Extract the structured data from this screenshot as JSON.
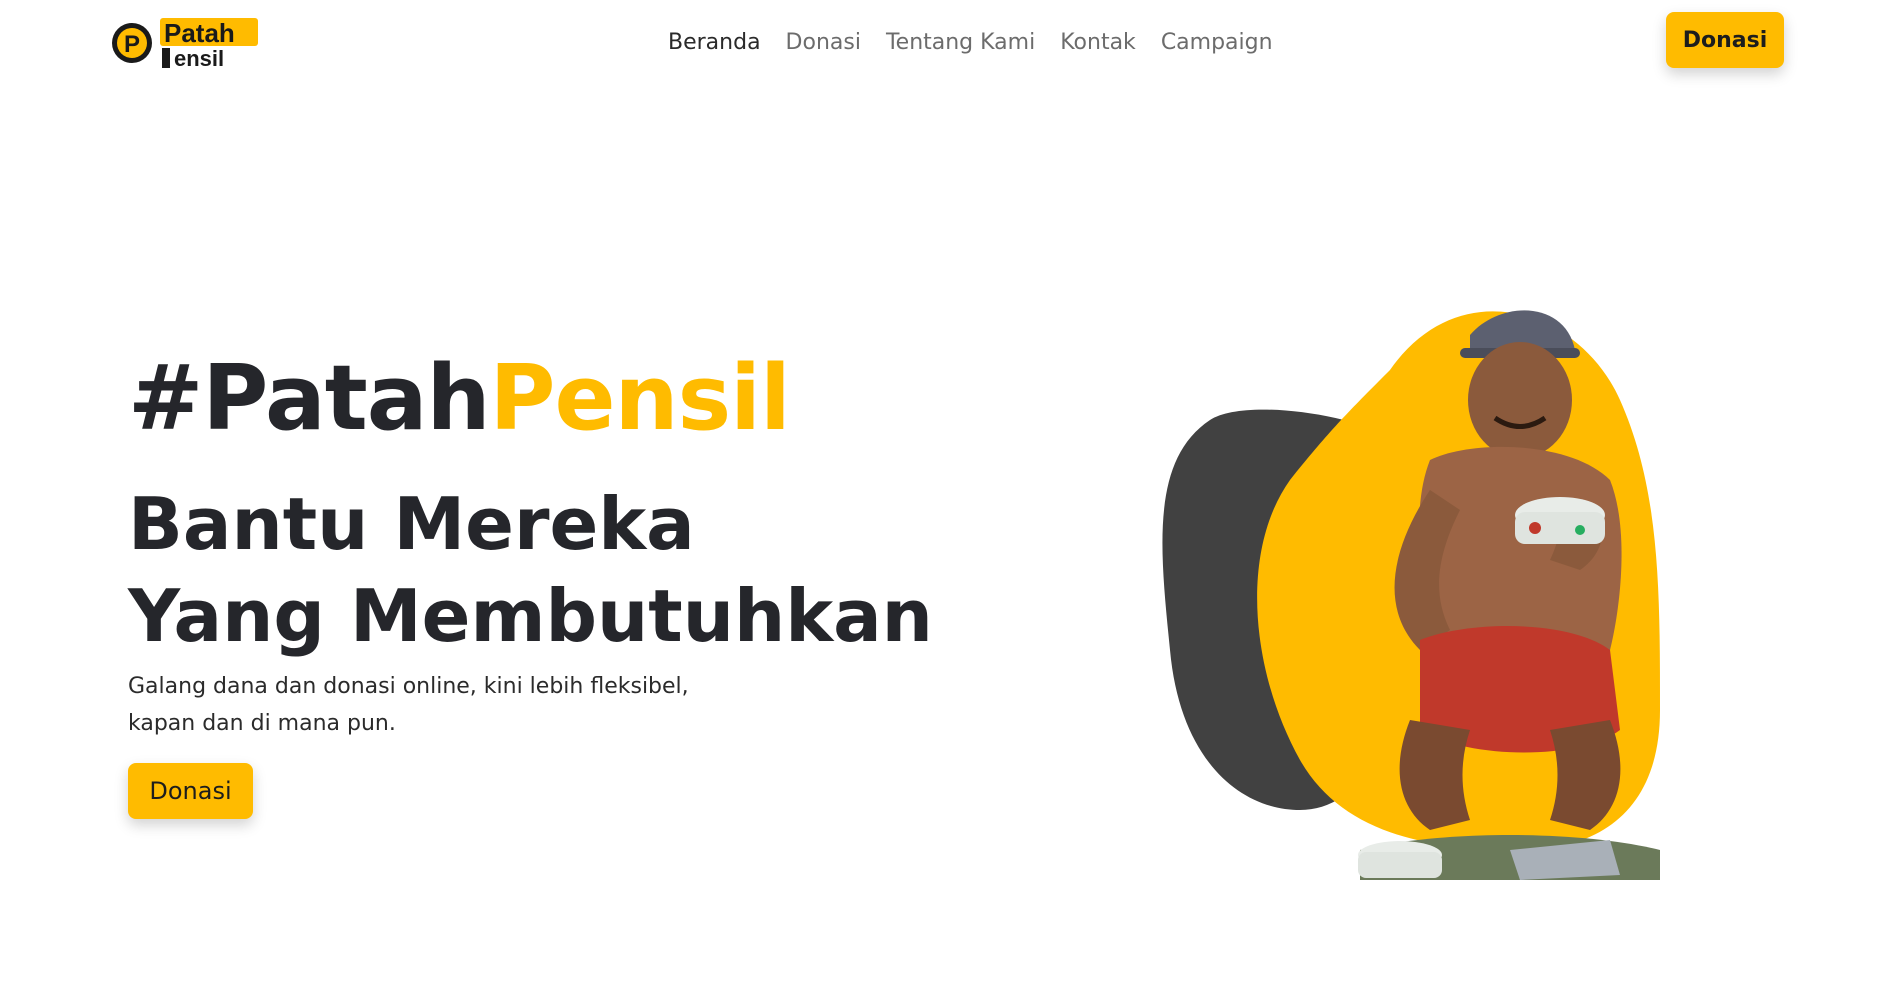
{
  "brand": {
    "logo_line1": "Patah",
    "logo_line2": "ensil",
    "logo_mark": "P",
    "colors": {
      "accent": "#ffbb00",
      "dark": "#25262b",
      "blob_dark": "#414141"
    }
  },
  "nav": {
    "items": [
      {
        "label": "Beranda",
        "active": true
      },
      {
        "label": "Donasi",
        "active": false
      },
      {
        "label": "Tentang Kami",
        "active": false
      },
      {
        "label": "Kontak",
        "active": false
      },
      {
        "label": "Campaign",
        "active": false
      }
    ],
    "cta_label": "Donasi"
  },
  "hero": {
    "hashtag_prefix": "#Patah",
    "hashtag_accent": "Pensil",
    "subtitle_line1": "Bantu Mereka",
    "subtitle_line2": "Yang Membutuhkan",
    "description_line1": "Galang dana dan donasi online, kini lebih fleksibel,",
    "description_line2": "kapan dan di mana pun.",
    "cta_label": "Donasi",
    "image_icon": "person-eating-illustration"
  }
}
